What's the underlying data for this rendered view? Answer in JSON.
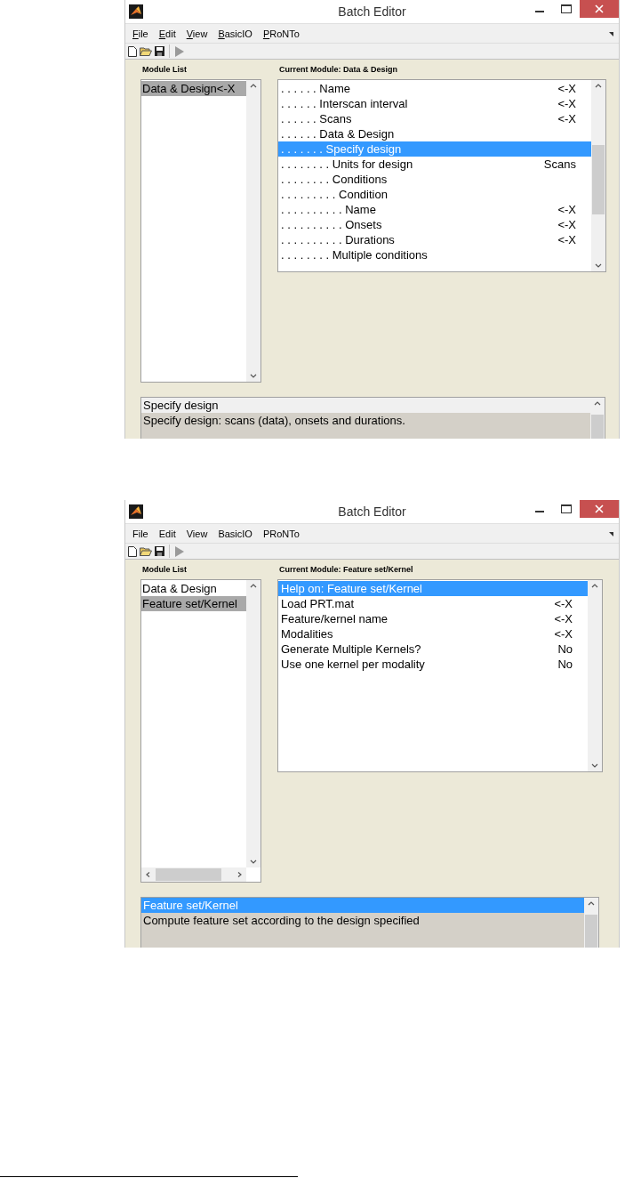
{
  "windows": [
    {
      "title": "Batch Editor",
      "mnemonics": true,
      "menu": [
        "File",
        "Edit",
        "View",
        "BasicIO",
        "PRoNTo"
      ],
      "module_list_label": "Module List",
      "modules": [
        {
          "label": "Data & Design<-X",
          "selected": true
        }
      ],
      "module_hscroll": false,
      "current_module_label": "Current Module: Data & Design",
      "items": [
        {
          "label": ". . . . . . Name",
          "value": "<-X",
          "selected": false
        },
        {
          "label": ". . . . . . Interscan interval",
          "value": "<-X",
          "selected": false
        },
        {
          "label": ". . . . . . Scans",
          "value": "<-X",
          "selected": false
        },
        {
          "label": ". . . . . . Data & Design",
          "selected": false
        },
        {
          "label": ". . . . . . . Specify design",
          "selected": true
        },
        {
          "label": ". . . . . . . . Units for design",
          "value": "Scans",
          "selected": false
        },
        {
          "label": ". . . . . . . . Conditions",
          "selected": false
        },
        {
          "label": ". . . . . . . . . Condition",
          "selected": false
        },
        {
          "label": ". . . . . . . . . . Name",
          "value": "<-X",
          "selected": false
        },
        {
          "label": ". . . . . . . . . . Onsets",
          "value": "<-X",
          "selected": false
        },
        {
          "label": ". . . . . . . . . . Durations",
          "value": "<-X",
          "selected": false
        },
        {
          "label": ". . . . . . . . Multiple conditions",
          "selected": false
        }
      ],
      "help": {
        "title": "Specify design",
        "selected": false,
        "text": "Specify design: scans (data), onsets and durations."
      }
    },
    {
      "title": "Batch Editor",
      "mnemonics": false,
      "menu": [
        "File",
        "Edit",
        "View",
        "BasicIO",
        "PRoNTo"
      ],
      "module_list_label": "Module List",
      "modules": [
        {
          "label": "Data & Design",
          "selected": false
        },
        {
          "label": "Feature set/Kernel",
          "selected": true
        }
      ],
      "module_hscroll": true,
      "current_module_label": "Current Module: Feature set/Kernel",
      "items": [
        {
          "label": "Help on: Feature set/Kernel",
          "selected": true
        },
        {
          "label": "Load PRT.mat",
          "value": "<-X",
          "selected": false
        },
        {
          "label": "Feature/kernel name",
          "value": "<-X",
          "selected": false
        },
        {
          "label": "Modalities",
          "value": "<-X",
          "selected": false
        },
        {
          "label": "Generate Multiple Kernels?",
          "value": "No",
          "selected": false
        },
        {
          "label": "Use one kernel per modality",
          "value": "No",
          "selected": false
        }
      ],
      "help": {
        "title": "Feature set/Kernel",
        "selected": true,
        "text": "Compute feature set according to the design specified"
      }
    }
  ]
}
